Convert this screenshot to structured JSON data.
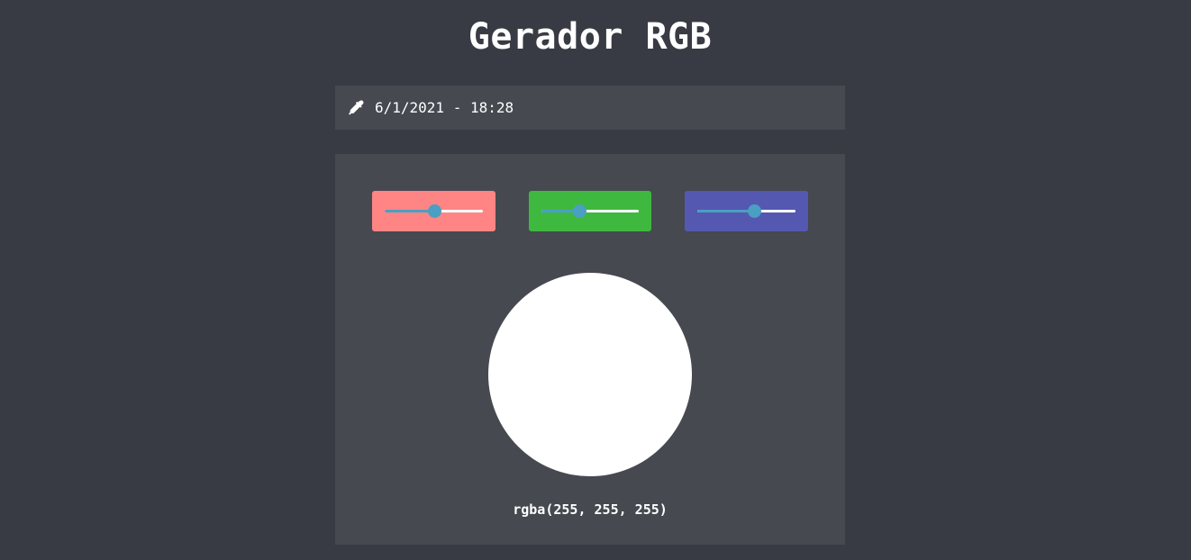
{
  "title": "Gerador RGB",
  "info_bar": {
    "icon": "eyedropper-icon",
    "timestamp": "6/1/2021 - 18:28"
  },
  "colors": {
    "background": "#383b43",
    "panel": "#464950",
    "red": "#ff8585",
    "green": "#3fb83f",
    "blue": "#5558b0",
    "slider_fill": "#4a9fc2",
    "preview": "#ffffff"
  },
  "sliders": [
    {
      "channel": "red",
      "value_fraction": 0.5
    },
    {
      "channel": "green",
      "value_fraction": 0.39
    },
    {
      "channel": "blue",
      "value_fraction": 0.58
    }
  ],
  "readout": "rgba(255, 255, 255)"
}
